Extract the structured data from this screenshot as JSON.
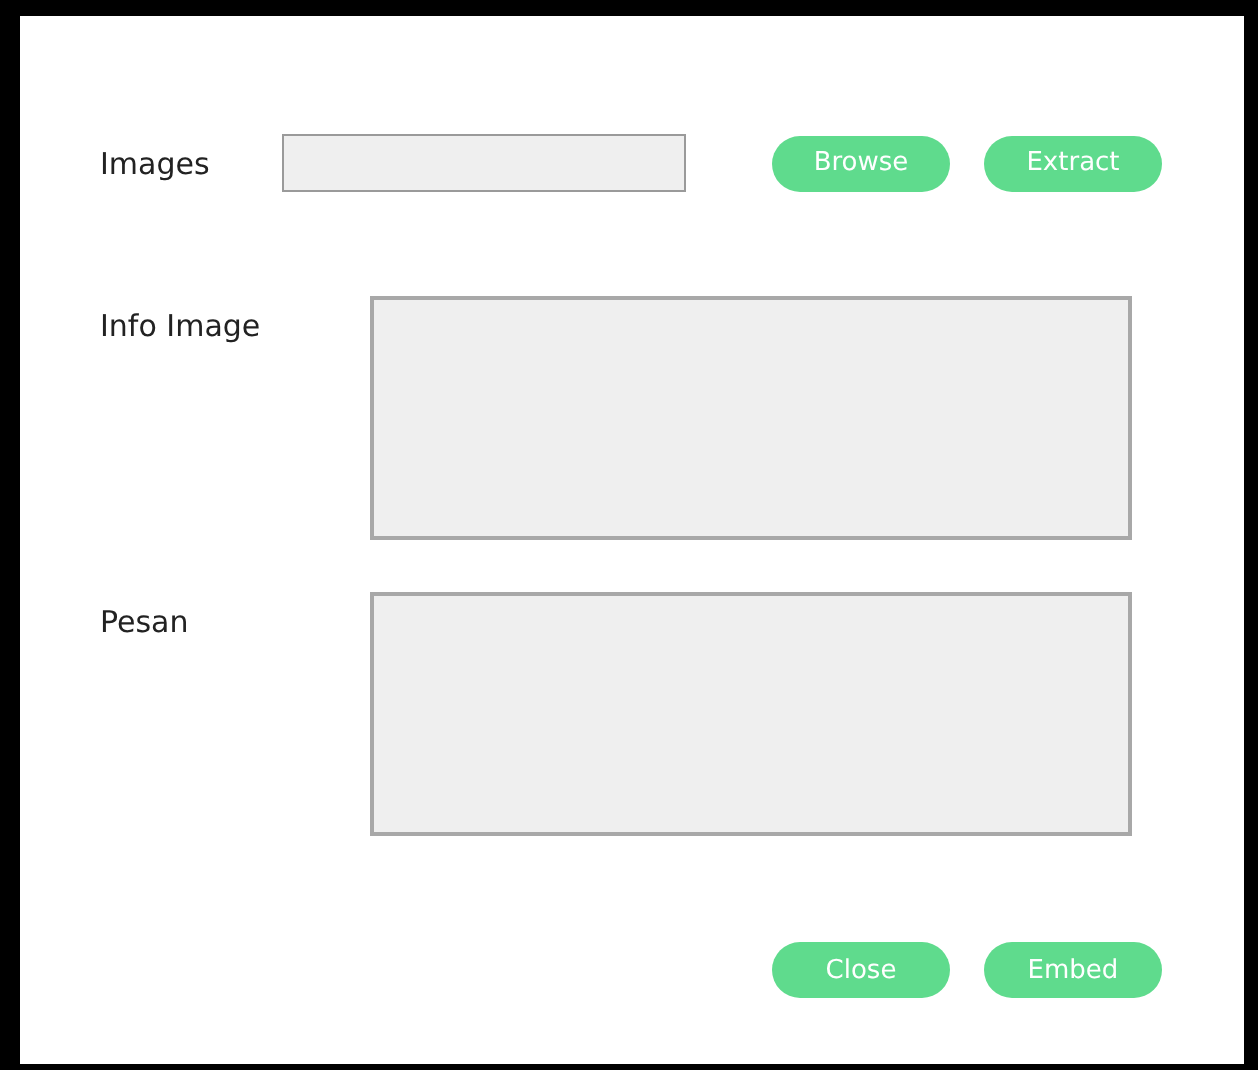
{
  "image_row": {
    "label": "Images",
    "buttons": [
      "Browse",
      "Extract"
    ]
  },
  "text_areas": [
    {
      "label": "Info Image"
    },
    {
      "label": "Pesan"
    }
  ],
  "footer_buttons": [
    "Close",
    "Embed"
  ]
}
